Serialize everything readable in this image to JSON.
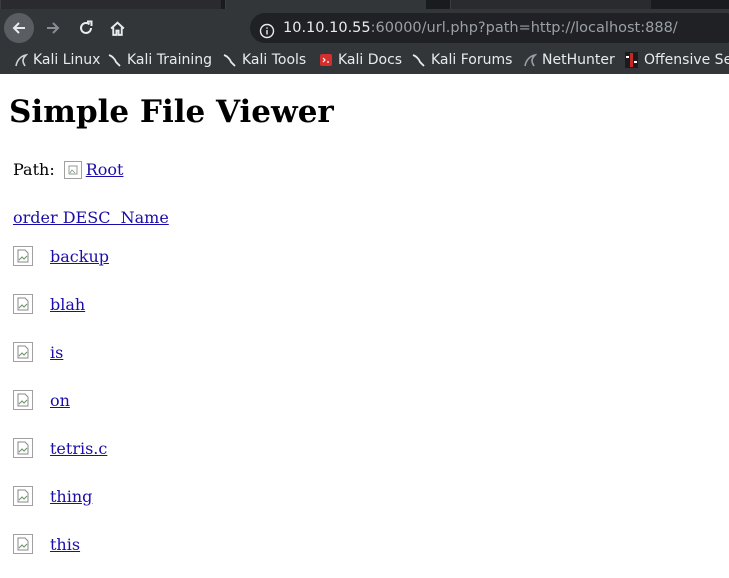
{
  "browser": {
    "url_host": "10.10.10.55",
    "url_rest": ":60000/url.php?path=http://localhost:888/",
    "bookmarks": [
      {
        "label": "Kali Linux",
        "icon": "kali-dragon-icon"
      },
      {
        "label": "Kali Training",
        "icon": "kali-dragon-icon"
      },
      {
        "label": "Kali Tools",
        "icon": "kali-dragon-icon"
      },
      {
        "label": "Kali Docs",
        "icon": "kali-docs-icon"
      },
      {
        "label": "Kali Forums",
        "icon": "kali-dragon-icon"
      },
      {
        "label": "NetHunter",
        "icon": "kali-dragon-icon"
      },
      {
        "label": "Offensive Sec",
        "icon": "offsec-icon"
      }
    ]
  },
  "page": {
    "title": "Simple File Viewer",
    "path_label": "Path:",
    "root_link": "Root",
    "sort_link": "order DESC  Name",
    "files": [
      "backup",
      "blah",
      "is",
      "on",
      "tetris.c",
      "thing",
      "this"
    ]
  },
  "colors": {
    "link": "#1a0dab",
    "chrome_bg": "#323639",
    "urlbar_bg": "#202124"
  }
}
